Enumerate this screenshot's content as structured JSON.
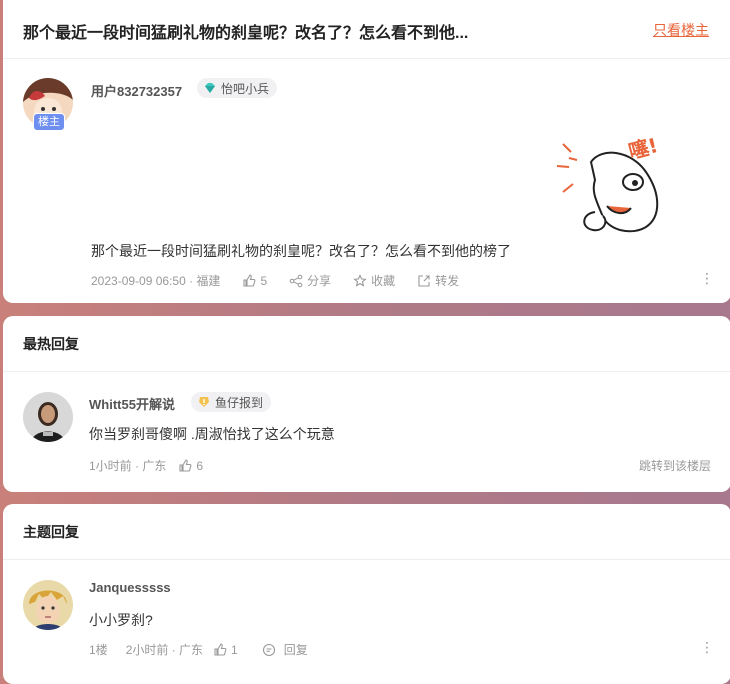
{
  "thread": {
    "title": "那个最近一段时间猛刷礼物的刹皇呢？改名了？怎么看不到他...",
    "only_op_label": "只看楼主"
  },
  "op_post": {
    "username": "用户832732357",
    "badge": "怡吧小兵",
    "op_tag": "楼主",
    "sticker_text": "噻!",
    "content": "那个最近一段时间猛刷礼物的刹皇呢？改名了？怎么看不到他的榜了",
    "timestamp": "2023-09-09 06:50",
    "location": "· 福建",
    "likes": "5",
    "share": "分享",
    "favorite": "收藏",
    "forward": "转发",
    "more": "⋮"
  },
  "hot_replies": {
    "section_title": "最热回复",
    "items": [
      {
        "username": "Whitt55开解说",
        "badge": "鱼仔报到",
        "content": "你当罗刹哥傻啊 .周淑怡找了这么个玩意",
        "time": "1小时前 · 广东",
        "likes": "6",
        "jump": "跳转到该楼层"
      }
    ]
  },
  "topic_replies": {
    "section_title": "主题回复",
    "items": [
      {
        "username": "Janquesssss",
        "content": "小小罗刹?",
        "floor": "1楼",
        "time": "2小时前 · 广东",
        "likes": "1",
        "reply": "回复",
        "more": "⋮"
      }
    ]
  },
  "colors": {
    "accent": "#e8643a",
    "op_tag": "#6f8ff0",
    "muted": "#999999"
  }
}
